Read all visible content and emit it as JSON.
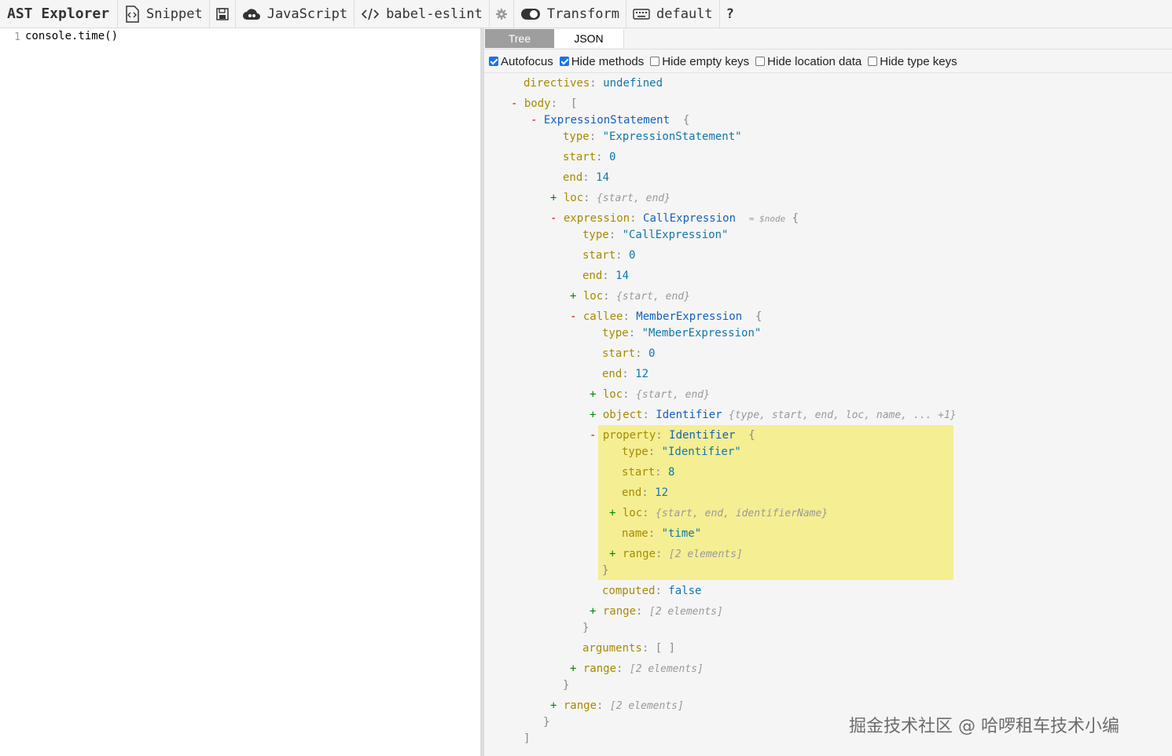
{
  "toolbar": {
    "title": "AST Explorer",
    "snippet": "Snippet",
    "language": "JavaScript",
    "parser": "babel-eslint",
    "transform": "Transform",
    "keymap": "default",
    "help": "?"
  },
  "editor": {
    "line_number": "1",
    "code": "console.time()"
  },
  "panel": {
    "tabs": [
      "Tree",
      "JSON"
    ],
    "options": [
      {
        "label": "Autofocus",
        "checked": true
      },
      {
        "label": "Hide methods",
        "checked": true
      },
      {
        "label": "Hide empty keys",
        "checked": false
      },
      {
        "label": "Hide location data",
        "checked": false
      },
      {
        "label": "Hide type keys",
        "checked": false
      }
    ]
  },
  "tree": {
    "directives_key": "directives",
    "directives_val": "undefined",
    "body_key": "body",
    "expr_stmt": "ExpressionStatement",
    "type_key": "type",
    "start_key": "start",
    "end_key": "end",
    "loc_key": "loc",
    "range_key": "range",
    "expr_stmt_type": "\"ExpressionStatement\"",
    "zero": "0",
    "fourteen": "14",
    "twelve": "12",
    "eight": "8",
    "loc_summary": "{start, end}",
    "expression_key": "expression",
    "call_expr": "CallExpression",
    "node_hint": "= $node",
    "call_expr_type": "\"CallExpression\"",
    "callee_key": "callee",
    "member_expr": "MemberExpression",
    "member_expr_type": "\"MemberExpression\"",
    "object_key": "object",
    "identifier": "Identifier",
    "object_summary": "{type, start, end, loc, name, ... +1}",
    "property_key": "property",
    "identifier_type": "\"Identifier\"",
    "loc_summary_ident": "{start, end, identifierName}",
    "name_key": "name",
    "name_val": "\"time\"",
    "range_summary": "[2 elements]",
    "computed_key": "computed",
    "computed_val": "false",
    "arguments_key": "arguments",
    "arguments_val": "[ ]"
  },
  "watermark": "掘金技术社区 @ 哈啰租车技术小编"
}
